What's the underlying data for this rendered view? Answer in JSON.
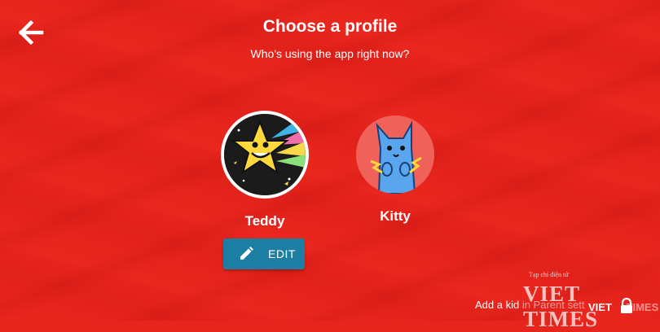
{
  "header": {
    "title": "Choose a profile",
    "subtitle": "Who's using the app right now?"
  },
  "profiles": [
    {
      "name": "Teddy",
      "avatar_icon": "star-avatar-icon"
    },
    {
      "name": "Kitty",
      "avatar_icon": "cat-avatar-icon"
    }
  ],
  "edit_button": {
    "label": "EDIT",
    "icon": "pencil-icon"
  },
  "footer": {
    "text_visible": "Add a kid",
    "text_faint": "in Parent sett"
  },
  "watermark": {
    "tagline": "Tạp chí điện tử",
    "brand": "VIET TIMES",
    "brand_small": "VIET",
    "brand_small_faint": "TIMES"
  },
  "colors": {
    "background": "#e8251d",
    "edit_button": "#1c7ea2",
    "kitty_avatar": "#f0615a"
  }
}
